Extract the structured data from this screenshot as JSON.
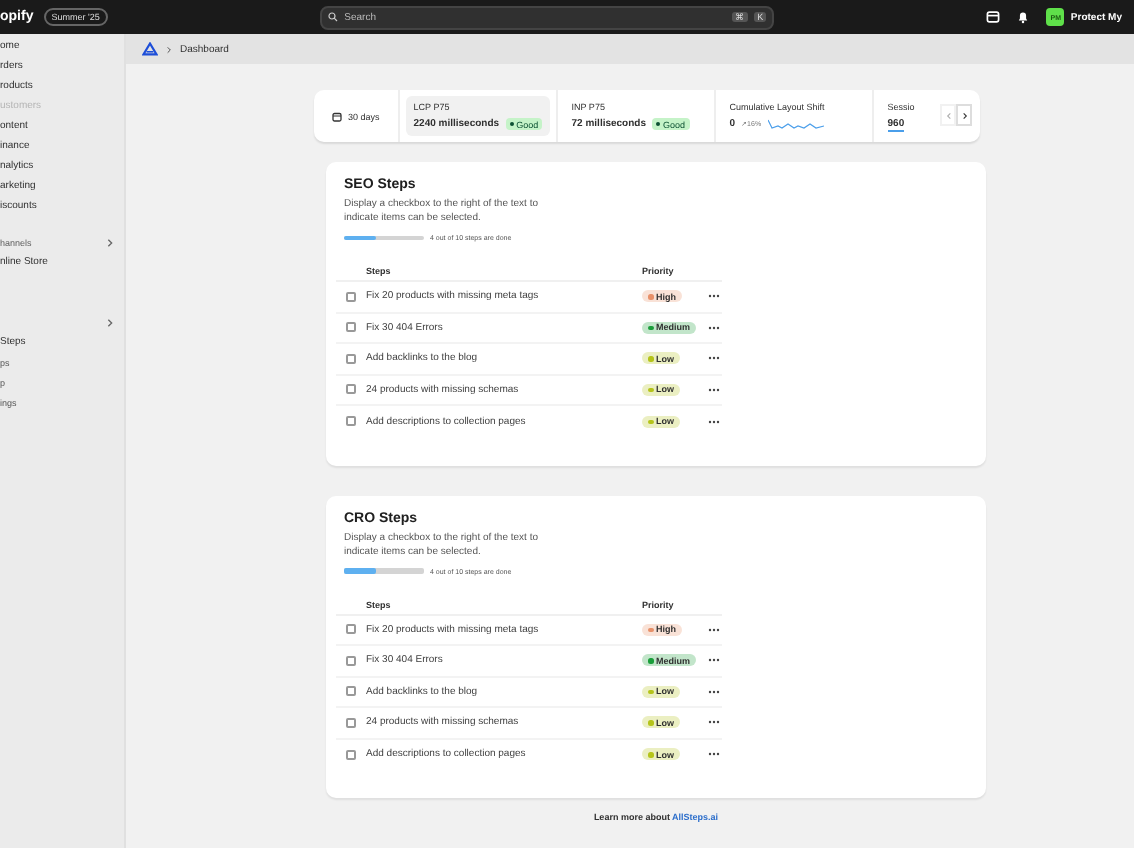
{
  "topbar": {
    "logo": "opify",
    "edition": "Summer '25",
    "search": {
      "placeholder": "Search",
      "keys": [
        "⌘",
        "K"
      ]
    },
    "store": {
      "initials": "PM",
      "name": "Protect My"
    }
  },
  "sidebar": {
    "items": [
      {
        "label": "ome",
        "kind": "item",
        "disabled": false
      },
      {
        "label": "rders",
        "kind": "item",
        "disabled": false
      },
      {
        "label": "roducts",
        "kind": "item",
        "disabled": false
      },
      {
        "label": "ustomers",
        "kind": "item",
        "disabled": true
      },
      {
        "label": "ontent",
        "kind": "item",
        "disabled": false
      },
      {
        "label": "inance",
        "kind": "item",
        "disabled": false
      },
      {
        "label": "nalytics",
        "kind": "item",
        "disabled": false
      },
      {
        "label": "arketing",
        "kind": "item",
        "disabled": false
      },
      {
        "label": "iscounts",
        "kind": "item",
        "disabled": false
      },
      {
        "label": "hannels",
        "kind": "heading"
      },
      {
        "label": "nline Store",
        "kind": "item",
        "disabled": false
      },
      {
        "kind": "spacer"
      },
      {
        "kind": "heading"
      },
      {
        "label": "Steps",
        "kind": "item",
        "disabled": false
      },
      {
        "label": "ps",
        "kind": "sub",
        "disabled": false
      },
      {
        "label": "p",
        "kind": "sub",
        "disabled": false
      },
      {
        "label": "ings",
        "kind": "sub",
        "disabled": false
      }
    ]
  },
  "breadcrumb": {
    "page": "Dashboard"
  },
  "metrics": {
    "period": "30 days",
    "cards": [
      {
        "kind": "badge",
        "title": "LCP P75",
        "value": "2240 milliseconds",
        "badge": "Good",
        "selected": true
      },
      {
        "kind": "badge",
        "title": "INP P75",
        "value": "72 milliseconds",
        "badge": "Good",
        "selected": false
      },
      {
        "kind": "trend",
        "title": "Cumulative Layout Shift",
        "value": "0",
        "change": "↗16%",
        "selected": false
      },
      {
        "kind": "cut",
        "title": "Sessio",
        "value": "960",
        "selected": false
      }
    ],
    "prev_disabled": true
  },
  "sections": [
    {
      "title": "SEO Steps",
      "description": "Display a checkbox to the right of the text to indicate items can be selected.",
      "level": 0.4,
      "progress_text": "4 out of 10 steps are done",
      "columns": [
        "Steps",
        "Priority"
      ],
      "rows": [
        {
          "step": "Fix 20 products with missing meta tags",
          "checked": false,
          "priority": "High",
          "color": "#e8916a"
        },
        {
          "step": "Fix 30 404 Errors",
          "checked": false,
          "priority": "Medium",
          "color": "#1a9e3a"
        },
        {
          "step": "Add backlinks to the blog",
          "checked": false,
          "priority": "Low",
          "color": "#b5c41a"
        },
        {
          "step": "24 products with missing schemas",
          "checked": false,
          "priority": "Low",
          "color": "#b5c41a"
        },
        {
          "step": "Add descriptions to collection pages",
          "checked": false,
          "priority": "Low",
          "color": "#b5c41a"
        }
      ]
    },
    {
      "title": "CRO Steps",
      "description": "Display a checkbox to the right of the text to indicate items can be selected.",
      "level": 0.4,
      "progress_text": "4 out of 10 steps are done",
      "columns": [
        "Steps",
        "Priority"
      ],
      "rows": [
        {
          "step": "Fix 20 products with missing meta tags",
          "checked": false,
          "priority": "High",
          "color": "#e8916a"
        },
        {
          "step": "Fix 30 404 Errors",
          "checked": false,
          "priority": "Medium",
          "color": "#1a9e3a"
        },
        {
          "step": "Add backlinks to the blog",
          "checked": false,
          "priority": "Low",
          "color": "#b5c41a"
        },
        {
          "step": "24 products with missing schemas",
          "checked": false,
          "priority": "Low",
          "color": "#b5c41a"
        },
        {
          "step": "Add descriptions to collection pages",
          "checked": false,
          "priority": "Low",
          "color": "#b5c41a"
        }
      ]
    }
  ],
  "footer": {
    "text": "Learn more about",
    "link": "AllSteps.ai"
  }
}
